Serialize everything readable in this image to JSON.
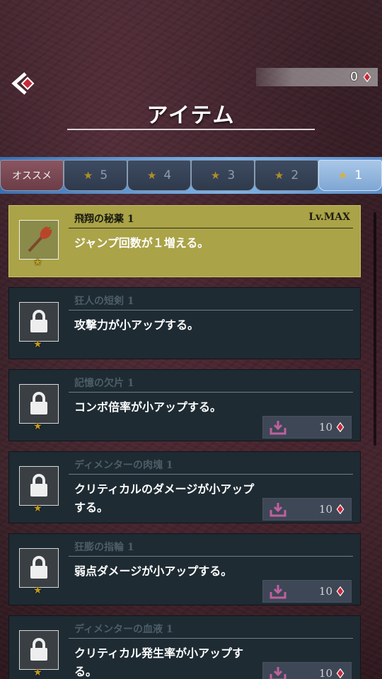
{
  "header": {
    "title": "アイテム",
    "gem_count": "0"
  },
  "tabs": [
    {
      "label": "オススメ",
      "star": ""
    },
    {
      "label": "5",
      "star": "★"
    },
    {
      "label": "4",
      "star": "★"
    },
    {
      "label": "3",
      "star": "★"
    },
    {
      "label": "2",
      "star": "★"
    },
    {
      "label": "1",
      "star": "★"
    }
  ],
  "items": [
    {
      "name": "飛翔の秘薬 1",
      "level": "Lv.MAX",
      "desc": "ジャンプ回数が１増える。",
      "cost": "",
      "rank": "★"
    },
    {
      "name": "狂人の短剣 1",
      "level": "",
      "desc": "攻撃力が小アップする。",
      "cost": "",
      "rank": "★"
    },
    {
      "name": "記憶の欠片 1",
      "level": "",
      "desc": "コンボ倍率が小アップする。",
      "cost": "10",
      "rank": "★"
    },
    {
      "name": "ディメンターの肉塊 1",
      "level": "",
      "desc": "クリティカルのダメージが小アップする。",
      "cost": "10",
      "rank": "★"
    },
    {
      "name": "狂膨の指輪 1",
      "level": "",
      "desc": "弱点ダメージが小アップする。",
      "cost": "10",
      "rank": "★"
    },
    {
      "name": "ディメンターの血液 1",
      "level": "",
      "desc": "クリティカル発生率が小アップする。",
      "cost": "10",
      "rank": "★"
    }
  ],
  "colors": {
    "highlight": "#aaa348",
    "card": "#1e2b33",
    "gem": "#c8283a"
  }
}
